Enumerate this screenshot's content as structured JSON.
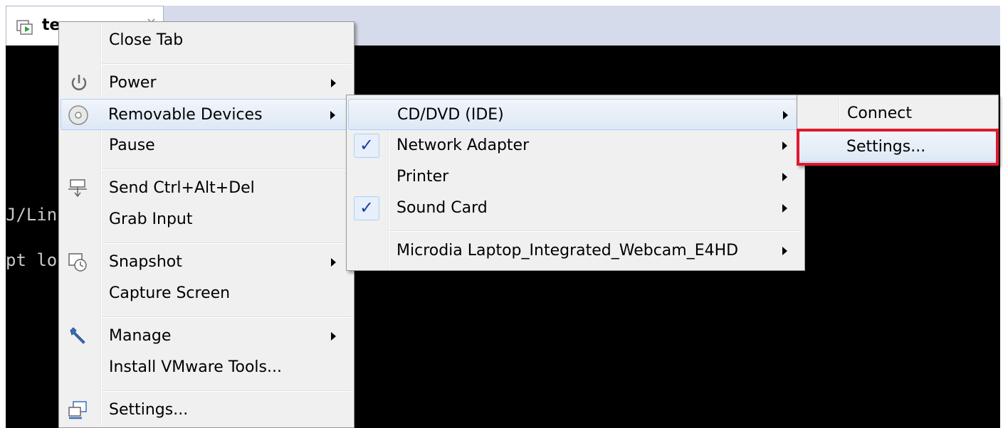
{
  "tab": {
    "label": "te",
    "close": "×"
  },
  "console": {
    "line1": "J/Lin",
    "line2": "pt lo"
  },
  "main_menu": {
    "close_tab": "Close Tab",
    "power": "Power",
    "removable_devices": "Removable Devices",
    "pause": "Pause",
    "send_cad": "Send Ctrl+Alt+Del",
    "grab_input": "Grab Input",
    "snapshot": "Snapshot",
    "capture_screen": "Capture Screen",
    "manage": "Manage",
    "install_tools": "Install VMware Tools...",
    "settings": "Settings..."
  },
  "devices_menu": {
    "cd_dvd": "CD/DVD (IDE)",
    "network_adapter": "Network Adapter",
    "network_adapter_checked": true,
    "printer": "Printer",
    "sound_card": "Sound Card",
    "sound_card_checked": true,
    "webcam": "Microdia Laptop_Integrated_Webcam_E4HD",
    "check_glyph": "✓"
  },
  "cd_menu": {
    "connect": "Connect",
    "settings": "Settings..."
  },
  "colors": {
    "highlight_outline": "#e0182d",
    "menu_bg": "#f0f0f0",
    "console_bg": "#000000"
  },
  "icons": [
    "vm-tab-icon",
    "power-icon",
    "disc-icon",
    "keyboard-icon",
    "snapshot-icon",
    "wrench-icon",
    "settings-icon"
  ]
}
